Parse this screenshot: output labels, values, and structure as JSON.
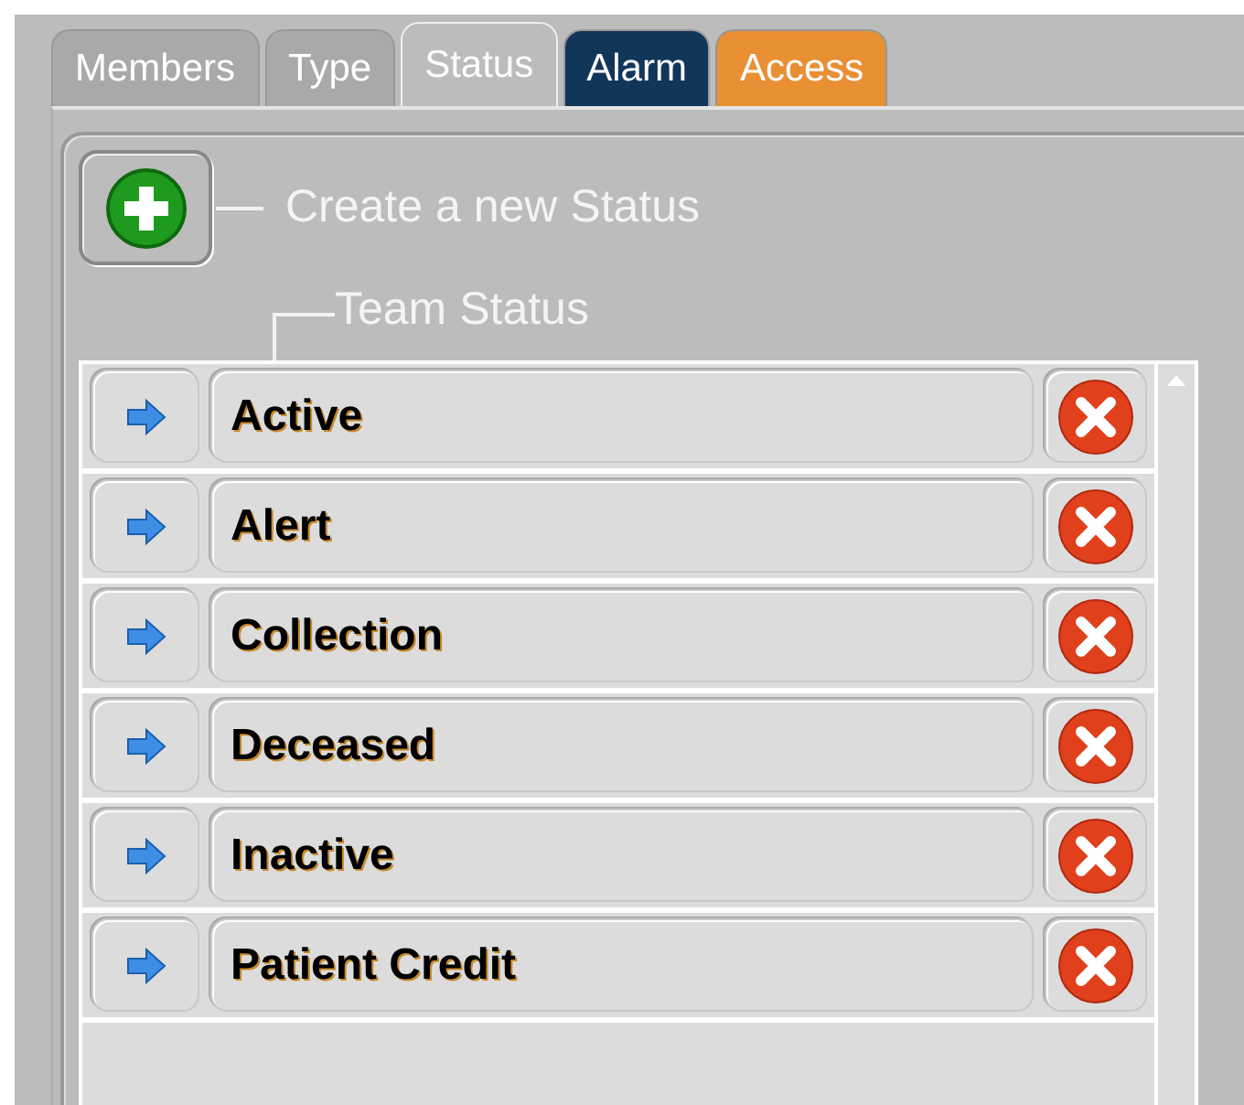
{
  "tabs": [
    {
      "label": "Members",
      "selected": false,
      "color": "#a9a9a9"
    },
    {
      "label": "Type",
      "selected": false,
      "color": "#a9a9a9"
    },
    {
      "label": "Status",
      "selected": true,
      "color": "#bcbcbc"
    },
    {
      "label": "Alarm",
      "selected": false,
      "color": "#12355a"
    },
    {
      "label": "Access",
      "selected": false,
      "color": "#e98f34"
    }
  ],
  "create_label": "Create a new Status",
  "list_title": "Team Status",
  "statuses": [
    {
      "name": "Active"
    },
    {
      "name": "Alert"
    },
    {
      "name": "Collection"
    },
    {
      "name": "Deceased"
    },
    {
      "name": "Inactive"
    },
    {
      "name": "Patient Credit"
    }
  ]
}
